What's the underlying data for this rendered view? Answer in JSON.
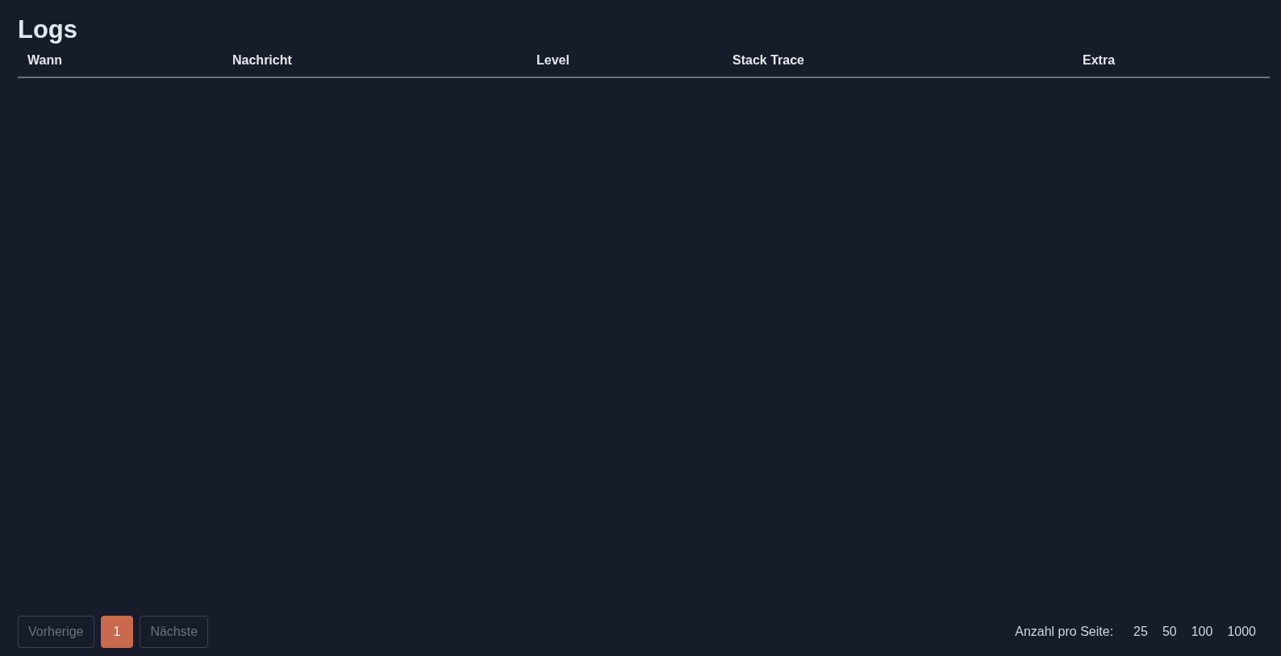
{
  "title": "Logs",
  "table": {
    "columns": [
      "Wann",
      "Nachricht",
      "Level",
      "Stack Trace",
      "Extra"
    ]
  },
  "pagination": {
    "previous": {
      "label": "Vorherige",
      "disabled": true
    },
    "pages": [
      {
        "label": "1",
        "selected": true
      }
    ],
    "next": {
      "label": "Nächste",
      "disabled": true
    }
  },
  "page_size": {
    "label": "Anzahl pro Seite:",
    "options": [
      "25",
      "50",
      "100",
      "1000"
    ]
  }
}
